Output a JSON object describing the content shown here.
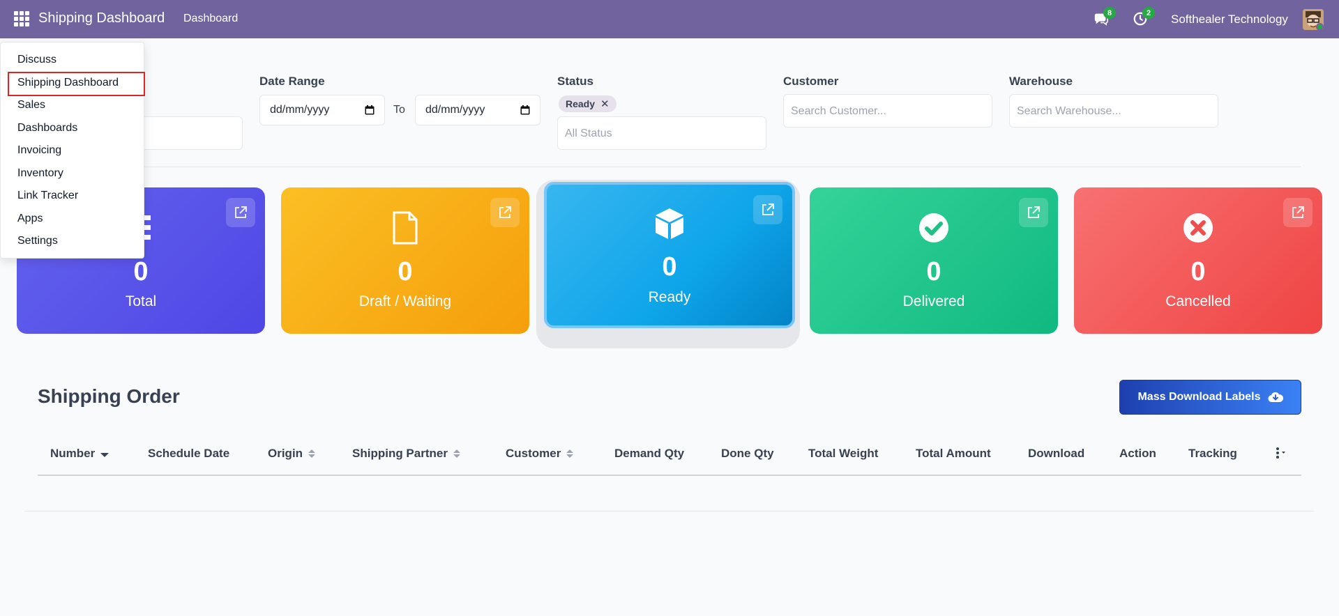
{
  "navbar": {
    "brand": "Shipping Dashboard",
    "menu_item": "Dashboard",
    "messages_badge": "8",
    "activities_badge": "2",
    "company": "Softhealer Technology"
  },
  "app_menu": {
    "items": [
      "Discuss",
      "Shipping Dashboard",
      "Sales",
      "Dashboards",
      "Invoicing",
      "Inventory",
      "Link Tracker",
      "Apps",
      "Settings"
    ],
    "highlighted": "Shipping Dashboard"
  },
  "filters": {
    "date_range_label": "Date Range",
    "date_from_value": "dd/mm/yyyy",
    "to_label": "To",
    "date_to_value": "dd/mm/yyyy",
    "status_label": "Status",
    "status_tag": "Ready",
    "status_tag_remove": "✕",
    "status_placeholder": "All Status",
    "customer_label": "Customer",
    "customer_placeholder": "Search Customer...",
    "warehouse_label": "Warehouse",
    "warehouse_placeholder": "Search Warehouse..."
  },
  "cards": [
    {
      "count": "0",
      "label": "Total",
      "icon": "list-icon",
      "color": "#5b5be8"
    },
    {
      "count": "0",
      "label": "Draft / Waiting",
      "icon": "file-icon",
      "color": "#f5a623"
    },
    {
      "count": "0",
      "label": "Ready",
      "icon": "box-icon",
      "color": "#1ea0e0"
    },
    {
      "count": "0",
      "label": "Delivered",
      "icon": "check-circle-icon",
      "color": "#21c487"
    },
    {
      "count": "0",
      "label": "Cancelled",
      "icon": "x-circle-icon",
      "color": "#ef5555"
    }
  ],
  "section": {
    "title": "Shipping Order",
    "mass_download_label": "Mass Download Labels"
  },
  "table": {
    "columns": [
      "Number",
      "Schedule Date",
      "Origin",
      "Shipping Partner",
      "Customer",
      "Demand Qty",
      "Done Qty",
      "Total Weight",
      "Total Amount",
      "Download",
      "Action",
      "Tracking"
    ]
  }
}
